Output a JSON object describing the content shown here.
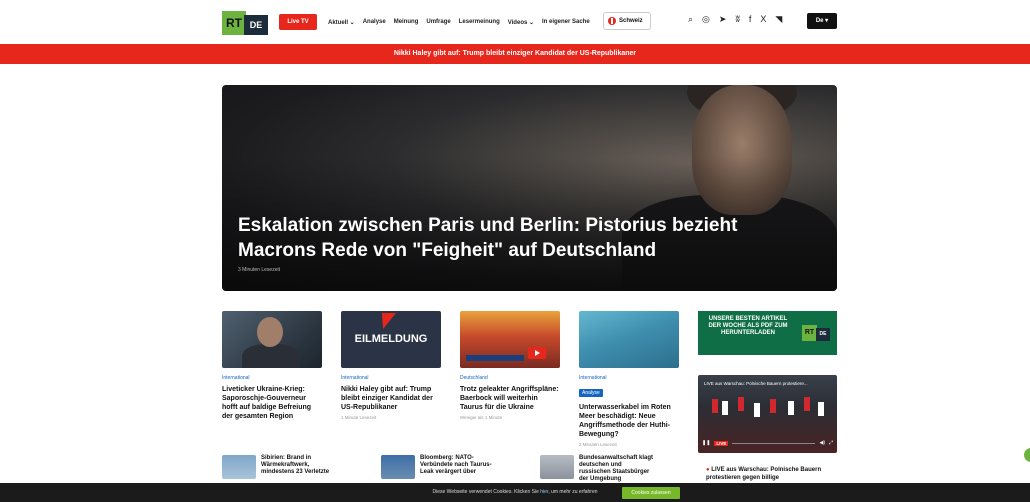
{
  "header": {
    "logo_rt": "RT",
    "logo_de": "DE",
    "live_tv": "Live TV",
    "nav": [
      "Aktuell ⌄",
      "Analyse",
      "Meinung",
      "Umfrage",
      "Lesermeinung",
      "Videos ⌄",
      "In eigener Sache"
    ],
    "region": "Schweiz",
    "icons": [
      "search-icon",
      "instagram-icon",
      "telegram-icon",
      "vk-icon",
      "facebook-icon",
      "x-icon",
      "rss-icon"
    ],
    "lang": "De ▾"
  },
  "breaking": "Nikki Haley gibt auf: Trump bleibt einziger Kandidat der US-Republikaner",
  "hero": {
    "title": "Eskalation zwischen Paris und Berlin: Pistorius bezieht Macrons Rede von \"Feigheit\" auf Deutschland",
    "read_time": "3 Minuten Lesezeit"
  },
  "cards": [
    {
      "category": "International",
      "title": "Liveticker Ukraine-Krieg: Saporoschje-Gouverneur hofft auf baldige Befreiung der gesamten Region",
      "meta": ""
    },
    {
      "category": "International",
      "title": "Nikki Haley gibt auf: Trump bleibt einziger Kandidat der US-Republikaner",
      "meta": "1 Minute Lesezeit",
      "image_text": "EILMELDUNG"
    },
    {
      "category": "Deutschland",
      "title": "Trotz geleakter Angriffspläne: Baerbock will weiterhin Taurus für die Ukraine",
      "meta": "Weniger als 1 Minute"
    },
    {
      "category": "International",
      "badge": "Analyse",
      "title": "Unterwasserkabel im Roten Meer beschädigt: Neue Angriffsmethode der Huthi-Bewegung?",
      "meta": "2 Minuten Lesezeit"
    }
  ],
  "promo": {
    "text": "UNSERE BESTEN ARTIKEL DER WOCHE ALS PDF ZUM HERUNTERLADEN",
    "logo_rt": "RT",
    "logo_de": "DE"
  },
  "video": {
    "title": "LIVE aus Warschau: Polnische Bauern protestiere...",
    "live": "LIVE"
  },
  "live_link": "LIVE aus Warschau: Polnische Bauern protestieren gegen billige",
  "small_items": [
    "Sibirien: Brand in Wärmekraftwerk, mindestens 23 Verletzte",
    "Bloomberg: NATO-Verbündete nach Taurus-Leak verärgert über",
    "Bundesanwaltschaft klagt deutschen und russischen Staatsbürger der Umgebung"
  ],
  "cookie": {
    "text_before": "Diese Webseite verwendet Cookies. Klicken Sie ",
    "link": "hier",
    "text_after": ", um mehr zu erfahren",
    "button": "Cookies zulassen"
  }
}
